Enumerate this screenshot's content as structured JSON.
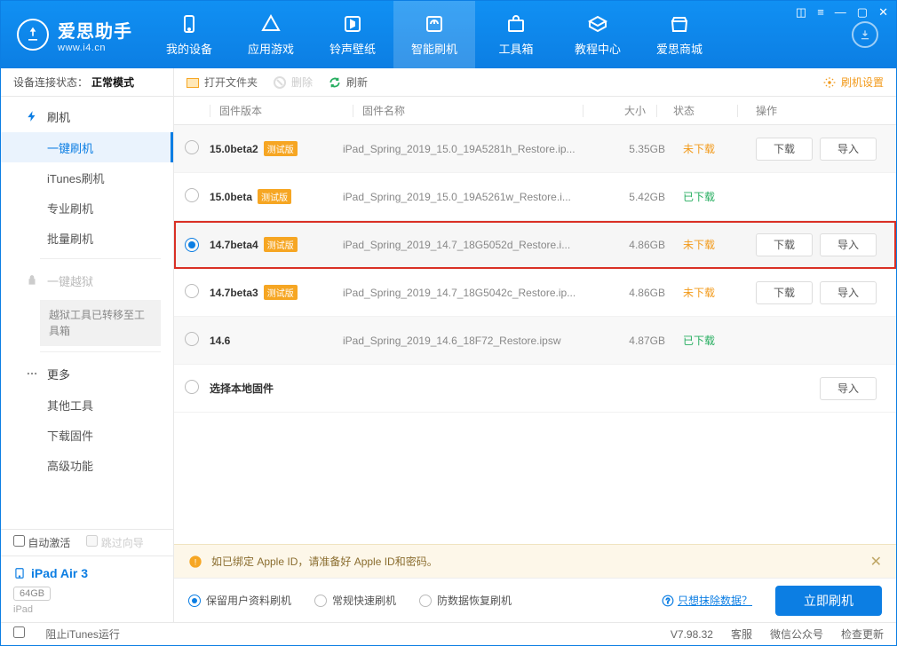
{
  "brand": {
    "title": "爱思助手",
    "sub": "www.i4.cn"
  },
  "nav": [
    {
      "label": "我的设备"
    },
    {
      "label": "应用游戏"
    },
    {
      "label": "铃声壁纸"
    },
    {
      "label": "智能刷机"
    },
    {
      "label": "工具箱"
    },
    {
      "label": "教程中心"
    },
    {
      "label": "爱思商城"
    }
  ],
  "conn": {
    "prefix": "设备连接状态：",
    "mode": "正常模式"
  },
  "side": {
    "flash": "刷机",
    "items": [
      "一键刷机",
      "iTunes刷机",
      "专业刷机",
      "批量刷机"
    ],
    "jailbreak": "一键越狱",
    "jb_notice": "越狱工具已转移至工具箱",
    "more": "更多",
    "more_items": [
      "其他工具",
      "下载固件",
      "高级功能"
    ]
  },
  "auto": {
    "activate": "自动激活",
    "skip": "跳过向导"
  },
  "device": {
    "name": "iPad Air 3",
    "capacity": "64GB",
    "type": "iPad"
  },
  "toolbar": {
    "open": "打开文件夹",
    "delete": "删除",
    "refresh": "刷新",
    "settings": "刷机设置"
  },
  "cols": {
    "version": "固件版本",
    "name": "固件名称",
    "size": "大小",
    "status": "状态",
    "ops": "操作"
  },
  "rows": [
    {
      "version": "15.0beta2",
      "beta": true,
      "name": "iPad_Spring_2019_15.0_19A5281h_Restore.ip...",
      "size": "5.35GB",
      "status": "未下载",
      "download": true,
      "import": true,
      "selected": false,
      "highlight": false
    },
    {
      "version": "15.0beta",
      "beta": true,
      "name": "iPad_Spring_2019_15.0_19A5261w_Restore.i...",
      "size": "5.42GB",
      "status": "已下载",
      "download": false,
      "import": false,
      "selected": false,
      "highlight": false
    },
    {
      "version": "14.7beta4",
      "beta": true,
      "name": "iPad_Spring_2019_14.7_18G5052d_Restore.i...",
      "size": "4.86GB",
      "status": "未下载",
      "download": true,
      "import": true,
      "selected": true,
      "highlight": true
    },
    {
      "version": "14.7beta3",
      "beta": true,
      "name": "iPad_Spring_2019_14.7_18G5042c_Restore.ip...",
      "size": "4.86GB",
      "status": "未下载",
      "download": true,
      "import": true,
      "selected": false,
      "highlight": false
    },
    {
      "version": "14.6",
      "beta": false,
      "name": "iPad_Spring_2019_14.6_18F72_Restore.ipsw",
      "size": "4.87GB",
      "status": "已下载",
      "download": false,
      "import": false,
      "selected": false,
      "highlight": false
    }
  ],
  "local_row": {
    "label": "选择本地固件",
    "import_label": "导入"
  },
  "btns": {
    "download": "下载",
    "import": "导入"
  },
  "beta_tag": "测试版",
  "warn": "如已绑定 Apple ID，请准备好 Apple ID和密码。",
  "opts": {
    "keep": "保留用户资料刷机",
    "regular": "常规快速刷机",
    "recover": "防数据恢复刷机",
    "erase_q": "只想抹除数据？",
    "flash": "立即刷机"
  },
  "footer": {
    "block": "阻止iTunes运行",
    "version": "V7.98.32",
    "service": "客服",
    "wechat": "微信公众号",
    "update": "检查更新"
  }
}
